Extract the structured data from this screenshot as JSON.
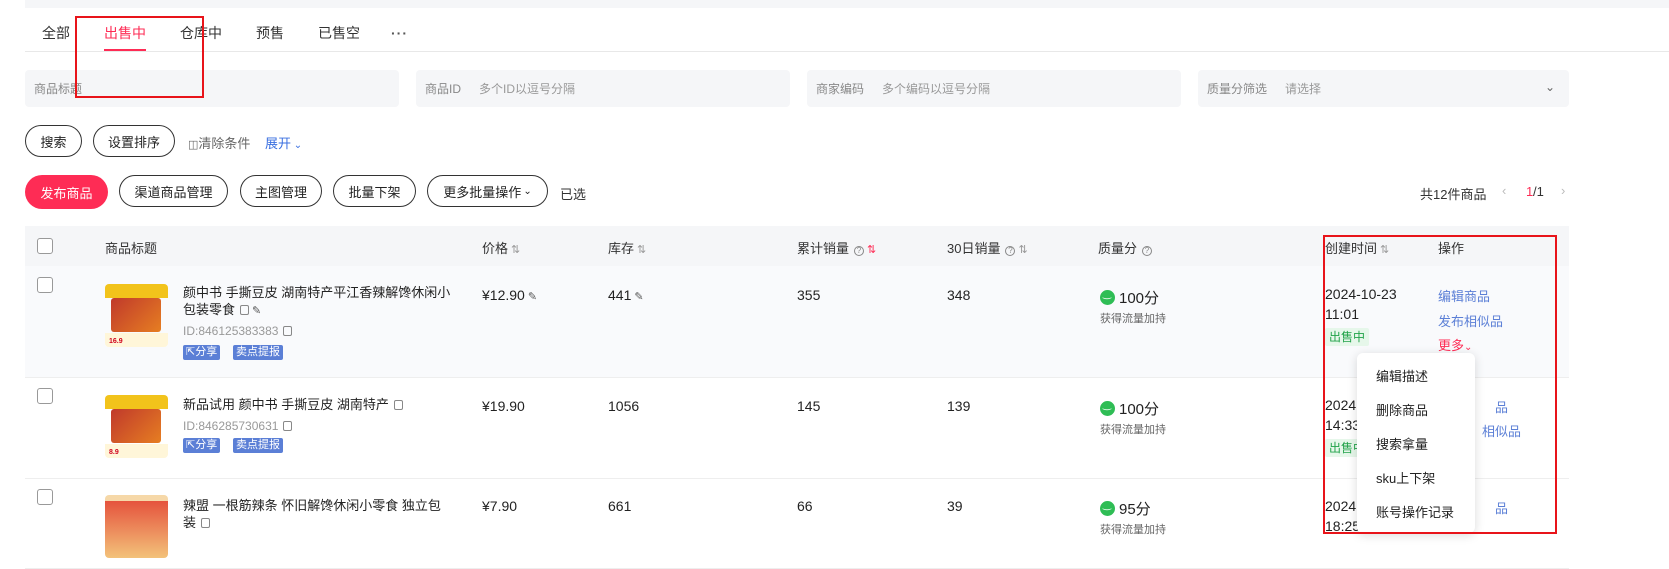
{
  "tabs": [
    {
      "label": "全部"
    },
    {
      "label": "出售中"
    },
    {
      "label": "仓库中"
    },
    {
      "label": "预售"
    },
    {
      "label": "已售空"
    },
    {
      "label": "···"
    }
  ],
  "filters": {
    "title": {
      "label": "商品标题",
      "placeholder": ""
    },
    "id": {
      "label": "商品ID",
      "placeholder": "多个ID以逗号分隔"
    },
    "code": {
      "label": "商家编码",
      "placeholder": "多个编码以逗号分隔"
    },
    "quality": {
      "label": "质量分筛选",
      "placeholder": "请选择"
    }
  },
  "actions": {
    "search": "搜索",
    "sort": "设置排序",
    "clear": "清除条件",
    "expand": "展开"
  },
  "toolbar": {
    "publish": "发布商品",
    "channel": "渠道商品管理",
    "main_image": "主图管理",
    "batch_offline": "批量下架",
    "more_batch": "更多批量操作",
    "selected": "已选",
    "total": "共12件商品",
    "page_current": "1",
    "page_total": "/1"
  },
  "table": {
    "headers": {
      "title": "商品标题",
      "price": "价格",
      "stock": "库存",
      "total_sales": "累计销量",
      "sales30": "30日销量",
      "quality": "质量分",
      "created": "创建时间",
      "ops": "操作"
    },
    "rows": [
      {
        "title": "颜中书 手撕豆皮 湖南特产平江香辣解馋休闲小包装零食",
        "id": "ID:846125383383",
        "tags": [
          "分享",
          "卖点提报"
        ],
        "thumb_price": "16.9",
        "price": "¥12.90",
        "stock": "441",
        "total_sales": "355",
        "sales30": "348",
        "score": "100分",
        "score_note": "获得流量加持",
        "created_date": "2024-10-23",
        "created_time": "11:01",
        "status": "出售中",
        "ops": [
          "编辑商品",
          "发布相似品",
          "更多"
        ]
      },
      {
        "title": "新品试用 颜中书 手撕豆皮 湖南特产",
        "id": "ID:846285730631",
        "tags": [
          "分享",
          "卖点提报"
        ],
        "thumb_price": "8.9",
        "price": "¥19.90",
        "stock": "1056",
        "total_sales": "145",
        "sales30": "139",
        "score": "100分",
        "score_note": "获得流量加持",
        "created_date": "2024",
        "created_time": "14:33",
        "status": "出售中",
        "ops": [
          "品",
          "相似品"
        ]
      },
      {
        "title": "辣盟 一根筋辣条 怀旧解馋休闲小零食 独立包装",
        "price": "¥7.90",
        "stock": "661",
        "total_sales": "66",
        "sales30": "39",
        "score": "95分",
        "score_note": "获得流量加持",
        "created_date": "2024",
        "created_time": "18:25",
        "ops": [
          "品"
        ]
      }
    ]
  },
  "dropdown": [
    "编辑描述",
    "删除商品",
    "搜索拿量",
    "sku上下架",
    "账号操作记录"
  ],
  "colors": {
    "accent": "#fe2c55",
    "link": "#5b7fd6",
    "highlight": "#e8141a"
  }
}
